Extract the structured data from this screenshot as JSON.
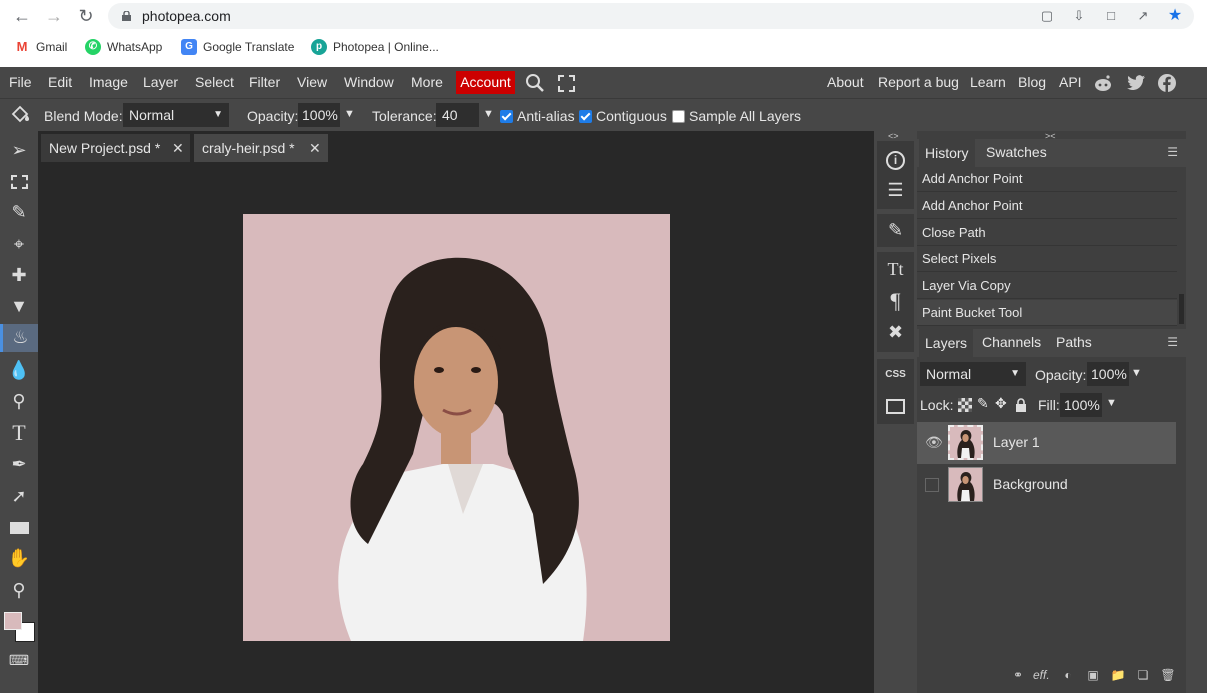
{
  "browser": {
    "url": "photopea.com",
    "bookmarks": [
      {
        "label": "Gmail",
        "icon": "gmail-icon"
      },
      {
        "label": "WhatsApp",
        "icon": "whatsapp-icon"
      },
      {
        "label": "Google Translate",
        "icon": "google-translate-icon"
      },
      {
        "label": "Photopea | Online...",
        "icon": "photopea-icon"
      }
    ]
  },
  "menu": {
    "items": [
      "File",
      "Edit",
      "Image",
      "Layer",
      "Select",
      "Filter",
      "View",
      "Window",
      "More"
    ],
    "account": "Account",
    "right_items": [
      "About",
      "Report a bug",
      "Learn",
      "Blog",
      "API"
    ]
  },
  "options": {
    "blend_mode_label": "Blend Mode:",
    "blend_mode_value": "Normal",
    "opacity_label": "Opacity:",
    "opacity_value": "100%",
    "tolerance_label": "Tolerance:",
    "tolerance_value": "40",
    "antialias_label": "Anti-alias",
    "antialias_checked": true,
    "contiguous_label": "Contiguous",
    "contiguous_checked": true,
    "sample_all_label": "Sample All Layers",
    "sample_all_checked": false
  },
  "tabs": [
    {
      "label": "New Project.psd *"
    },
    {
      "label": "craly-heir.psd *"
    }
  ],
  "history_panel": {
    "tabs": [
      "History",
      "Swatches"
    ],
    "items": [
      "Add Anchor Point",
      "Add Anchor Point",
      "Close Path",
      "Select Pixels",
      "Layer Via Copy",
      "Paint Bucket Tool"
    ]
  },
  "layers_panel": {
    "tabs": [
      "Layers",
      "Channels",
      "Paths"
    ],
    "blend_mode": "Normal",
    "opacity_label": "Opacity:",
    "opacity_value": "100%",
    "lock_label": "Lock:",
    "fill_label": "Fill:",
    "fill_value": "100%",
    "layers": [
      {
        "name": "Layer 1",
        "visible": true,
        "selected": true
      },
      {
        "name": "Background",
        "visible": false,
        "selected": false
      }
    ]
  },
  "sidebar": {
    "css_label": "CSS"
  },
  "colors": {
    "accent": "#cc0000",
    "canvas_bg": "#d8babc",
    "foreground": "#d8babc",
    "background": "#ffffff"
  }
}
